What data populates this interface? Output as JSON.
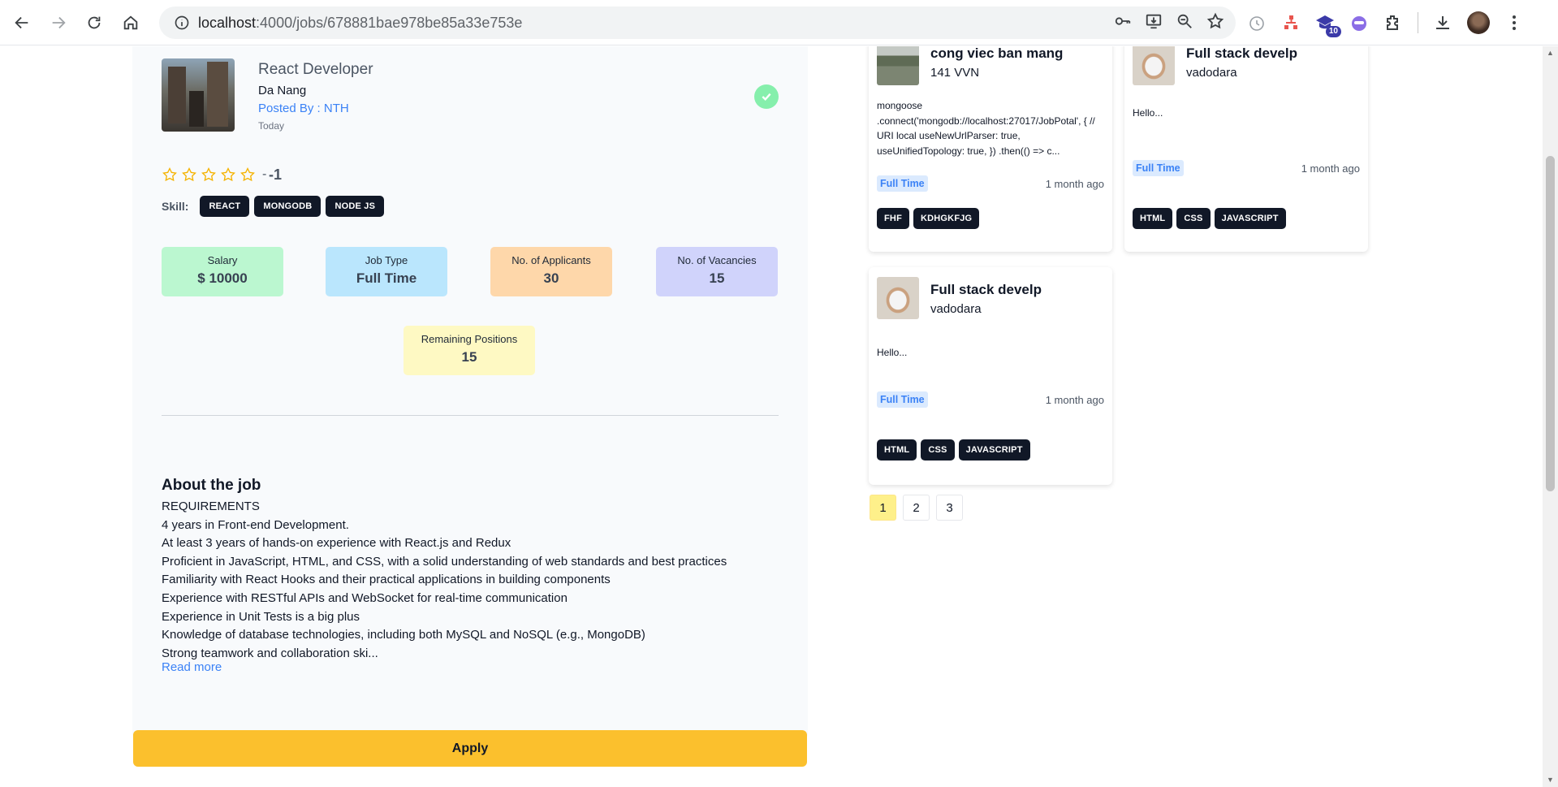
{
  "browser": {
    "url_host": "localhost",
    "url_path": ":4000/jobs/678881bae978be85a33e753e",
    "extension_badge": "10"
  },
  "job": {
    "title": "React Developer",
    "location": "Da Nang",
    "posted_by": "Posted By : NTH",
    "date": "Today",
    "rating_sep": "-",
    "rating_value": "-1",
    "rating_stars_filled": 0,
    "rating_stars_total": 5,
    "skills_label": "Skill:",
    "skills": [
      "REACT",
      "MONGODB",
      "NODE JS"
    ],
    "stats": {
      "salary_label": "Salary",
      "salary_value": "$ 10000",
      "type_label": "Job Type",
      "type_value": "Full Time",
      "applicants_label": "No. of Applicants",
      "applicants_value": "30",
      "vacancies_label": "No. of Vacancies",
      "vacancies_value": "15",
      "remaining_label": "Remaining Positions",
      "remaining_value": "15"
    },
    "about_title": "About the job",
    "about_lines": [
      "REQUIREMENTS",
      "4 years in Front-end Development.",
      "At least 3 years of hands-on experience with React.js and Redux",
      "Proficient in JavaScript, HTML, and CSS, with a solid understanding of web standards and best practices",
      "Familiarity with React Hooks and their practical applications in building components",
      "Experience with RESTful APIs and WebSocket for real-time communication",
      "Experience in Unit Tests is a big plus",
      "Knowledge of database technologies, including both MySQL and NoSQL (e.g., MongoDB)",
      "Strong teamwork and collaboration ski..."
    ],
    "read_more": "Read more",
    "apply_label": "Apply"
  },
  "related": [
    {
      "title": "cong viec ban mang",
      "subtitle": "141 VVN",
      "desc": "mongoose .connect('mongodb://localhost:27017/JobPotal', { // URI local useNewUrlParser: true, useUnifiedTopology: true, }) .then(() => c...",
      "type": "Full Time",
      "time": "1 month ago",
      "tags": [
        "FHF",
        "KDHGKFJG"
      ]
    },
    {
      "title": "Full stack develp",
      "subtitle": "vadodara",
      "desc": "Hello...",
      "type": "Full Time",
      "time": "1 month ago",
      "tags": [
        "HTML",
        "CSS",
        "JAVASCRIPT"
      ]
    },
    {
      "title": "Full stack develp",
      "subtitle": "vadodara",
      "desc": "Hello...",
      "type": "Full Time",
      "time": "1 month ago",
      "tags": [
        "HTML",
        "CSS",
        "JAVASCRIPT"
      ]
    }
  ],
  "pagination": {
    "pages": [
      "1",
      "2",
      "3"
    ],
    "active": "1"
  },
  "colors": {
    "apply": "#fbc02d",
    "salary": "#bbf7d0",
    "job_type": "#bae6fd",
    "applicants": "#fed7aa",
    "vacancies": "#d0d3fb",
    "remaining": "#fef9c3",
    "verified": "#86efac",
    "link": "#3b82f6"
  },
  "icons": [
    "back-icon",
    "forward-icon",
    "reload-icon",
    "home-icon",
    "site-info-icon",
    "password-key-icon",
    "install-app-icon",
    "zoom-icon",
    "bookmark-star-icon",
    "extension-icon",
    "download-icon",
    "profile-avatar",
    "menu-kebab-icon",
    "verified-check-icon",
    "star-icon"
  ]
}
